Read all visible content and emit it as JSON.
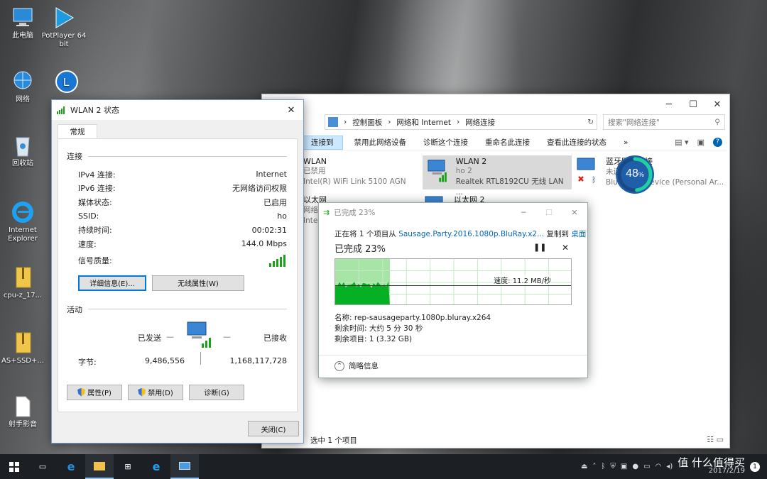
{
  "desktop": {
    "icons": [
      {
        "label": "此电脑"
      },
      {
        "label": "PotPlayer 64 bit"
      },
      {
        "label": "网络"
      },
      {
        "label": "回收站"
      },
      {
        "label": "Internet Explorer"
      },
      {
        "label": "cpu-z_17..."
      },
      {
        "label": "AS+SSD+..."
      },
      {
        "label": "射手影音"
      }
    ]
  },
  "wlan_status": {
    "title": "WLAN 2 状态",
    "tab": "常规",
    "connection_section": "连接",
    "rows": [
      {
        "key": "IPv4 连接:",
        "value": "Internet"
      },
      {
        "key": "IPv6 连接:",
        "value": "无网络访问权限"
      },
      {
        "key": "媒体状态:",
        "value": "已启用"
      },
      {
        "key": "SSID:",
        "value": "ho"
      },
      {
        "key": "持续时间:",
        "value": "00:02:31"
      },
      {
        "key": "速度:",
        "value": "144.0 Mbps"
      }
    ],
    "signal_label": "信号质量:",
    "signal_bars": 5,
    "details_btn": "详细信息(E)...",
    "wireless_btn": "无线属性(W)",
    "activity_section": "活动",
    "sent_label": "已发送",
    "received_label": "已接收",
    "bytes_label": "字节:",
    "bytes_sent": "9,486,556",
    "bytes_received": "1,168,117,728",
    "properties_btn": "属性(P)",
    "disable_btn": "禁用(D)",
    "diagnose_btn": "诊断(G)",
    "close_btn": "关闭(C)"
  },
  "explorer": {
    "breadcrumb": [
      "控制面板",
      "网络和 Internet",
      "网络连接"
    ],
    "search_placeholder": "搜索\"网络连接\"",
    "toolbar": [
      "连接到",
      "禁用此网络设备",
      "诊断这个连接",
      "重命名此连接",
      "查看此连接的状态"
    ],
    "more": "»",
    "items": [
      {
        "name": "WLAN",
        "status": "已禁用",
        "device": "Intel(R) WiFi Link 5100 AGN"
      },
      {
        "name": "WLAN 2",
        "status": "ho  2",
        "device": "Realtek RTL8192CU 无线 LAN ..."
      },
      {
        "name": "蓝牙网络连接",
        "status": "未连接",
        "device": "Bluetooth Device (Personal Ar..."
      },
      {
        "name": "以太网",
        "status": "网络",
        "device": "Intel..."
      },
      {
        "name": "以太网 2",
        "status": "",
        "device": ""
      }
    ],
    "statusbar": "选中 1 个项目"
  },
  "badge": {
    "value": "48",
    "unit": "%",
    "progress": 0.48
  },
  "copy": {
    "title": "已完成 23%",
    "line_prefix": "正在将 1 个项目从",
    "source": "Sausage.Party.2016.1080p.BluRay.x2...",
    "line_mid": "复制到",
    "dest": "桌面",
    "percent_text": "已完成 23%",
    "progress": 0.23,
    "speed": "速度: 11.2 MB/秒",
    "name_label": "名称:",
    "name": "rep-sausageparty.1080p.bluray.x264",
    "time_label": "剩余时间:",
    "time": "大约 5 分 30 秒",
    "items_label": "剩余项目:",
    "items": "1 (3.32 GB)",
    "less": "简略信息"
  },
  "taskbar": {
    "date": "2017/2/19",
    "watermark": "值 什么值得买",
    "notify_count": "1"
  },
  "colors": {
    "accent": "#0078d7",
    "progress_green": "#06b025",
    "taskbar": "#1c1f24"
  }
}
